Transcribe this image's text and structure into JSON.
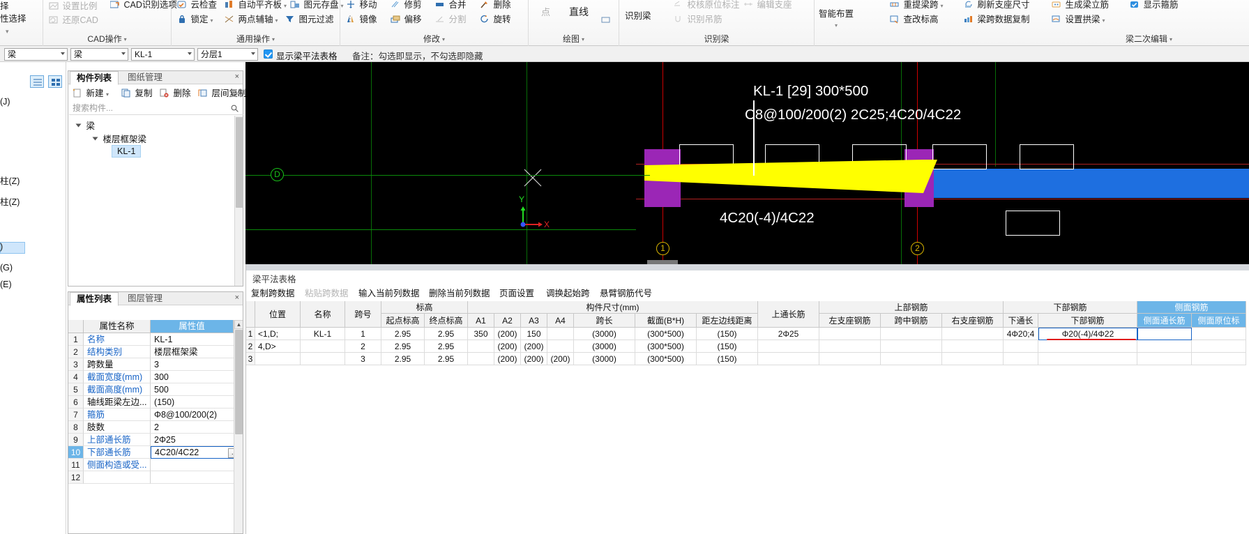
{
  "ribbon": {
    "groups": [
      {
        "title": "",
        "items": [
          {
            "label": "择",
            "icon": "none",
            "disabled": false
          },
          {
            "label": "性选择",
            "icon": "none",
            "disabled": false
          }
        ]
      },
      {
        "title": "CAD操作",
        "items": [
          {
            "label": "设置比例",
            "icon": "scale-icon",
            "disabled": true
          },
          {
            "label": "CAD识别选项",
            "icon": "cad-options-icon",
            "disabled": false
          },
          {
            "label": "还原CAD",
            "icon": "restore-cad-icon",
            "disabled": true
          }
        ]
      },
      {
        "title": "通用操作",
        "items": [
          {
            "label": "云检查",
            "icon": "cloud-check-icon",
            "disabled": false
          },
          {
            "label": "自动平齐板",
            "icon": "auto-align-icon",
            "disabled": false
          },
          {
            "label": "图元存盘",
            "icon": "element-save-icon",
            "disabled": false
          },
          {
            "label": "锁定",
            "icon": "lock-icon",
            "disabled": false
          },
          {
            "label": "两点辅轴",
            "icon": "two-point-axis-icon",
            "disabled": false
          },
          {
            "label": "图元过滤",
            "icon": "filter-icon",
            "disabled": false
          }
        ]
      },
      {
        "title": "修改",
        "items": [
          {
            "label": "移动",
            "icon": "move-icon",
            "disabled": false
          },
          {
            "label": "修剪",
            "icon": "trim-icon",
            "disabled": false
          },
          {
            "label": "合并",
            "icon": "merge-icon",
            "disabled": false
          },
          {
            "label": "删除",
            "icon": "delete-icon",
            "disabled": false
          },
          {
            "label": "镜像",
            "icon": "mirror-icon",
            "disabled": false
          },
          {
            "label": "偏移",
            "icon": "offset-icon",
            "disabled": false
          },
          {
            "label": "分割",
            "icon": "split-icon",
            "disabled": true
          },
          {
            "label": "旋转",
            "icon": "rotate-icon",
            "disabled": false
          }
        ]
      },
      {
        "title": "绘图",
        "items": [
          {
            "label": "点",
            "icon": "point-icon",
            "disabled": true
          },
          {
            "label": "直线",
            "icon": "line-icon",
            "disabled": false
          },
          {
            "label": "矩形",
            "icon": "rect-icon",
            "disabled": false
          }
        ]
      },
      {
        "title": "识别梁",
        "items": [
          {
            "label": "识别梁",
            "icon": "beam-recognize-icon",
            "disabled": true
          },
          {
            "label": "校核原位标注",
            "icon": "check-annotation-icon",
            "disabled": true
          },
          {
            "label": "编辑支座",
            "icon": "edit-support-icon",
            "disabled": true
          },
          {
            "label": "识别吊筋",
            "icon": "recognize-hanger-icon",
            "disabled": true
          }
        ]
      },
      {
        "title": "梁二次编辑",
        "items": [
          {
            "label": "智能布置",
            "icon": "smart-layout-icon",
            "disabled": false
          },
          {
            "label": "重提梁跨",
            "icon": "respan-icon",
            "disabled": false
          },
          {
            "label": "刷新支座尺寸",
            "icon": "refresh-support-icon",
            "disabled": false
          },
          {
            "label": "生成梁立筋",
            "icon": "gen-rebar-icon",
            "disabled": false
          },
          {
            "label": "显示箍筋",
            "icon": "show-stirrup-icon",
            "disabled": false
          },
          {
            "label": "查改标高",
            "icon": "check-elevation-icon",
            "disabled": false
          },
          {
            "label": "梁跨数据复制",
            "icon": "copy-span-data-icon",
            "disabled": false
          },
          {
            "label": "设置拱梁",
            "icon": "arch-beam-icon",
            "disabled": false
          }
        ]
      }
    ]
  },
  "optionbar": {
    "combo1": "梁",
    "combo2": "梁",
    "combo3": "KL-1",
    "combo4": "分层1",
    "checkbox_label": "显示梁平法表格",
    "checkbox_checked": true,
    "note": "备注：勾选即显示，不勾选即隐藏"
  },
  "leftrail": {
    "texts": [
      "(J)",
      "柱(Z)",
      "柱(Z)",
      "(G)",
      "(E)",
      "",
      ""
    ]
  },
  "component_panel": {
    "tabs": [
      {
        "label": "构件列表",
        "active": true
      },
      {
        "label": "图纸管理",
        "active": false
      }
    ],
    "close_icon": "×",
    "tools": [
      {
        "label": "新建",
        "icon": "new-icon",
        "has_caret": true
      },
      {
        "label": "复制",
        "icon": "copy-icon",
        "has_caret": false
      },
      {
        "label": "删除",
        "icon": "delete-icon",
        "has_caret": false
      },
      {
        "label": "层间复制",
        "icon": "copy-between-floors-icon",
        "has_caret": false
      },
      {
        "label": "»",
        "icon": "overflow-icon",
        "has_caret": false
      }
    ],
    "search_placeholder": "搜索构件...",
    "search_icon": "search-icon",
    "tree": [
      {
        "label": "梁",
        "level": 0
      },
      {
        "label": "楼层框架梁",
        "level": 1
      }
    ],
    "selected_item": "KL-1"
  },
  "property_panel": {
    "tabs": [
      {
        "label": "属性列表",
        "active": true
      },
      {
        "label": "图层管理",
        "active": false
      }
    ],
    "close_icon": "×",
    "headers": {
      "num": "",
      "name": "属性名称",
      "value": "属性值"
    },
    "rows": [
      {
        "n": "1",
        "name": "名称",
        "value": "KL-1",
        "blue": true,
        "selected": false,
        "btn": false
      },
      {
        "n": "2",
        "name": "结构类别",
        "value": "楼层框架梁",
        "blue": true,
        "selected": false,
        "btn": false
      },
      {
        "n": "3",
        "name": "跨数量",
        "value": "3",
        "blue": false,
        "selected": false,
        "btn": false
      },
      {
        "n": "4",
        "name": "截面宽度(mm)",
        "value": "300",
        "blue": true,
        "selected": false,
        "btn": false
      },
      {
        "n": "5",
        "name": "截面高度(mm)",
        "value": "500",
        "blue": true,
        "selected": false,
        "btn": false
      },
      {
        "n": "6",
        "name": "轴线距梁左边...",
        "value": "(150)",
        "blue": false,
        "selected": false,
        "btn": false
      },
      {
        "n": "7",
        "name": "箍筋",
        "value": "Φ8@100/200(2)",
        "blue": true,
        "selected": false,
        "btn": false
      },
      {
        "n": "8",
        "name": "肢数",
        "value": "2",
        "blue": false,
        "selected": false,
        "btn": false
      },
      {
        "n": "9",
        "name": "上部通长筋",
        "value": "2Φ25",
        "blue": true,
        "selected": false,
        "btn": false
      },
      {
        "n": "10",
        "name": "下部通长筋",
        "value": "4C20/4C22",
        "blue": true,
        "selected": true,
        "btn": true
      },
      {
        "n": "11",
        "name": "侧面构造或受...",
        "value": "",
        "blue": true,
        "selected": false,
        "btn": false
      },
      {
        "n": "12",
        "name": "",
        "value": "",
        "blue": true,
        "selected": false,
        "btn": false
      }
    ]
  },
  "canvas": {
    "annotation_line1": "KL-1 [29] 300*500",
    "annotation_line2": "C8@100/200(2) 2C25;4C20/4C22",
    "annotation_bottom": "4C20(-4)/4C22",
    "axis_labels": [
      {
        "text": "D",
        "kind": "green"
      },
      {
        "text": "1",
        "kind": "yellow"
      },
      {
        "text": "2",
        "kind": "yellow"
      }
    ],
    "ucs": {
      "x": "X",
      "y": "Y"
    },
    "colors": {
      "beam": "#ffff00",
      "column": "#9b26b6",
      "wall": "#1e6fe0",
      "grid": "#0b8a0b",
      "axis_red": "#cc0000",
      "background": "#000000"
    }
  },
  "table_panel": {
    "title": "梁平法表格",
    "tools": [
      {
        "label": "复制跨数据",
        "disabled": false
      },
      {
        "label": "粘贴跨数据",
        "disabled": true
      },
      {
        "label": "输入当前列数据",
        "disabled": false
      },
      {
        "label": "删除当前列数据",
        "disabled": false
      },
      {
        "label": "页面设置",
        "disabled": false
      },
      {
        "label": "调换起始跨",
        "disabled": false
      },
      {
        "label": "悬臂钢筋代号",
        "disabled": false
      }
    ],
    "group_headers": [
      {
        "label": "标高",
        "sub": [
          "起点标高",
          "终点标高"
        ]
      },
      {
        "label": "构件尺寸(mm)",
        "sub": [
          "A1",
          "A2",
          "A3",
          "A4",
          "跨长",
          "截面(B*H)",
          "距左边线距离"
        ]
      },
      {
        "label": "上部钢筋",
        "sub": [
          "左支座钢筋",
          "跨中钢筋",
          "右支座钢筋"
        ]
      },
      {
        "label": "下部钢筋",
        "sub": [
          "下通长",
          "下部钢筋"
        ]
      },
      {
        "label": "侧面钢筋",
        "sub": [
          "侧面通长筋",
          "侧面原位标"
        ]
      }
    ],
    "simple_headers": [
      "位置",
      "名称",
      "跨号",
      "上通长筋",
      "下通长"
    ],
    "rows": [
      {
        "rownum": "1",
        "position": "<1,D;",
        "name": "KL-1",
        "span": "1",
        "start_elev": "2.95",
        "end_elev": "2.95",
        "a1": "350",
        "a2": "(200)",
        "a3": "150",
        "a4": "",
        "span_len": "(3000)",
        "section": "(300*500)",
        "left_dist": "(150)",
        "top_through": "2Φ25",
        "left_support": "",
        "mid": "",
        "right_support": "",
        "bot_through": "4Φ20;4",
        "bot_rebar": "Φ20(-4)/4Φ22",
        "side_through": "",
        "side_insitu": ""
      },
      {
        "rownum": "2",
        "position": "4,D>",
        "name": "",
        "span": "2",
        "start_elev": "2.95",
        "end_elev": "2.95",
        "a1": "",
        "a2": "(200)",
        "a3": "(200)",
        "a4": "",
        "span_len": "(3000)",
        "section": "(300*500)",
        "left_dist": "(150)",
        "top_through": "",
        "left_support": "",
        "mid": "",
        "right_support": "",
        "bot_through": "",
        "bot_rebar": "",
        "side_through": "",
        "side_insitu": ""
      },
      {
        "rownum": "3",
        "position": "",
        "name": "",
        "span": "3",
        "start_elev": "2.95",
        "end_elev": "2.95",
        "a1": "",
        "a2": "(200)",
        "a3": "(200)",
        "a4": "(200)",
        "span_len": "(3000)",
        "section": "(300*500)",
        "left_dist": "(150)",
        "top_through": "",
        "left_support": "",
        "mid": "",
        "right_support": "",
        "bot_through": "",
        "bot_rebar": "",
        "side_through": "",
        "side_insitu": ""
      }
    ]
  }
}
